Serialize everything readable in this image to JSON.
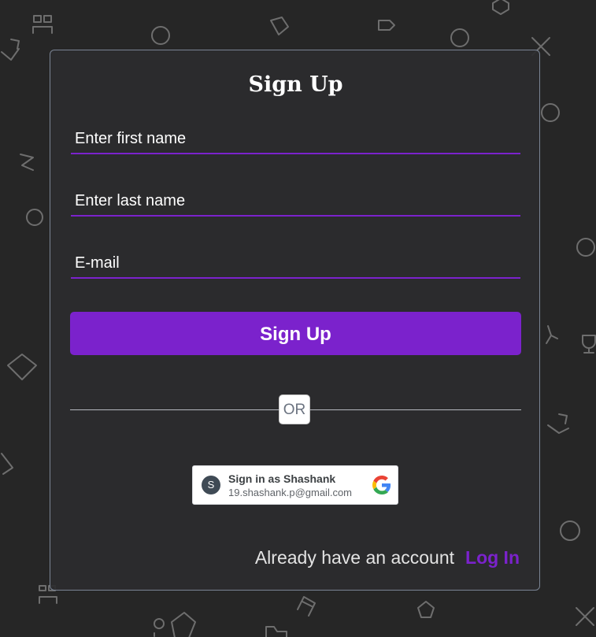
{
  "form": {
    "title": "Sign Up",
    "first_name_placeholder": "Enter first name",
    "last_name_placeholder": "Enter last name",
    "email_placeholder": "E-mail",
    "submit_label": "Sign Up",
    "divider_label": "OR"
  },
  "google": {
    "avatar_initial": "S",
    "name_label": "Sign in as Shashank",
    "email": "19.shashank.p@gmail.com",
    "logo_icon": "google-icon"
  },
  "footer": {
    "prompt": "Already have an account",
    "login_label": "Log In"
  },
  "colors": {
    "background": "#262626",
    "accent": "#7b22cc",
    "card_border": "#7a8494"
  }
}
